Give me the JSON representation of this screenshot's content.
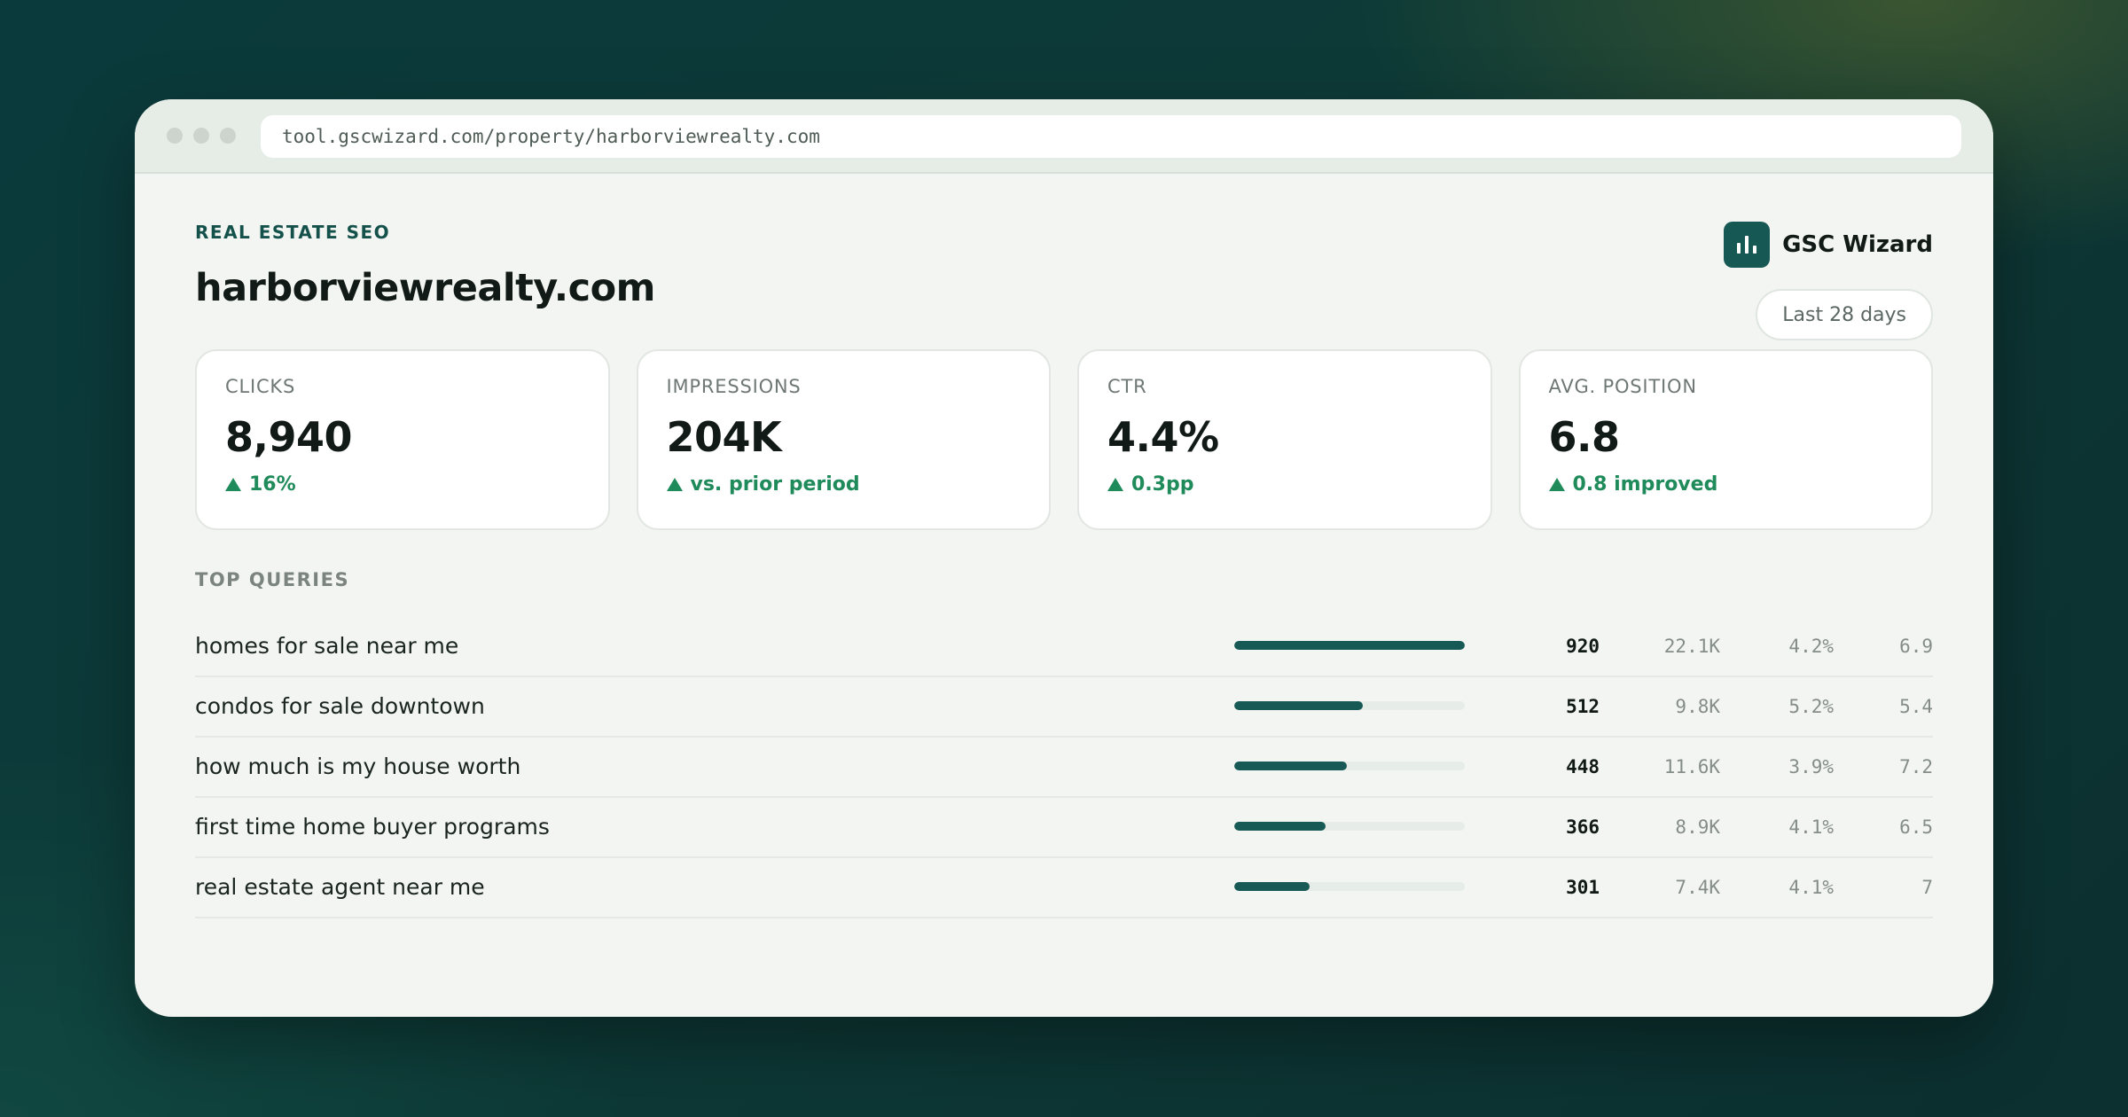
{
  "browser": {
    "url": "tool.gscwizard.com/property/harborviewrealty.com"
  },
  "header": {
    "eyebrow": "REAL ESTATE SEO",
    "site": "harborviewrealty.com",
    "brand_name": "GSC Wizard",
    "brand_icon": "bar-chart-icon",
    "date_range": "Last 28 days"
  },
  "kpis": [
    {
      "label": "CLICKS",
      "value": "8,940",
      "delta": "16%"
    },
    {
      "label": "IMPRESSIONS",
      "value": "204K",
      "delta": "vs. prior period"
    },
    {
      "label": "CTR",
      "value": "4.4%",
      "delta": "0.3pp"
    },
    {
      "label": "AVG. POSITION",
      "value": "6.8",
      "delta": "0.8 improved"
    }
  ],
  "colors": {
    "accent": "#165853",
    "positive": "#1f8a5a",
    "bar_fill": "#175a55",
    "bar_track": "#e6ece8"
  },
  "top_queries": {
    "title": "TOP QUERIES",
    "rows": [
      {
        "query": "homes for sale near me",
        "clicks": "920",
        "impressions": "22.1K",
        "ctr": "4.2%",
        "position": "6.9",
        "bar_fraction": 1.0
      },
      {
        "query": "condos for sale downtown",
        "clicks": "512",
        "impressions": "9.8K",
        "ctr": "5.2%",
        "position": "5.4",
        "bar_fraction": 0.556
      },
      {
        "query": "how much is my house worth",
        "clicks": "448",
        "impressions": "11.6K",
        "ctr": "3.9%",
        "position": "7.2",
        "bar_fraction": 0.487
      },
      {
        "query": "first time home buyer programs",
        "clicks": "366",
        "impressions": "8.9K",
        "ctr": "4.1%",
        "position": "6.5",
        "bar_fraction": 0.398
      },
      {
        "query": "real estate agent near me",
        "clicks": "301",
        "impressions": "7.4K",
        "ctr": "4.1%",
        "position": "7",
        "bar_fraction": 0.327
      }
    ]
  }
}
